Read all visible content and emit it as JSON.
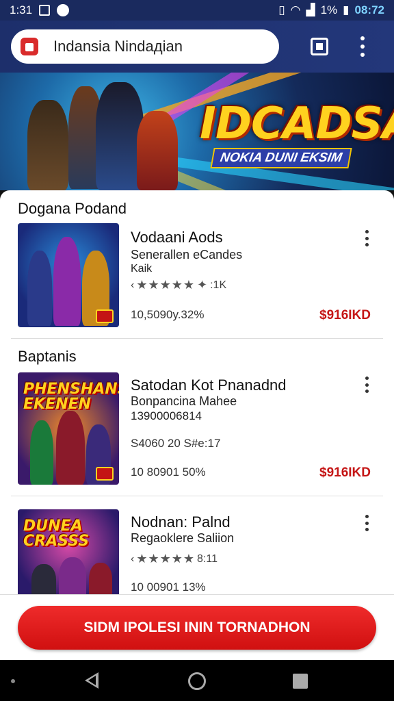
{
  "status_bar": {
    "time": "1:31",
    "clock_right": "08:72",
    "battery": "1%"
  },
  "browser": {
    "url_text": "Indansia Nindaдian"
  },
  "banner": {
    "title": "IDCADSA",
    "subtitle": "NOKIA DUNI EKSIM"
  },
  "sections": [
    {
      "title": "Dogana Podand",
      "items": [
        {
          "title": "Vodaani Aods",
          "sub1": "Senerallen eCandes",
          "sub2": "Kaik",
          "stars": "★★★★★",
          "rating_count": ":1K",
          "meta": "10,5090y.32%",
          "price": "$916IKD"
        }
      ]
    },
    {
      "title": "Baptanis",
      "items": [
        {
          "title": "Satodan Kot Pnanadnd",
          "sub1": "Bonpancina Mahee",
          "sub2": "13900006814",
          "sub3": "S4060  20  S#e:17",
          "meta": "10 80901 50%",
          "price": "$916IKD",
          "thumb_text": "PHENSHANS EKENEN"
        },
        {
          "title": "Nodnan: Palnd",
          "sub1": "Regaoklere Saliion",
          "stars": "★★★★★",
          "rating_count": "8:11",
          "meta": "10 00901 13%",
          "thumb_text": "DUNEA CRASSS"
        }
      ]
    }
  ],
  "cta": {
    "label": "SIDM IPOLESI ININ TORNADHON"
  },
  "colors": {
    "accent": "#d01010",
    "header": "#1d2f6b",
    "price": "#c51616"
  }
}
